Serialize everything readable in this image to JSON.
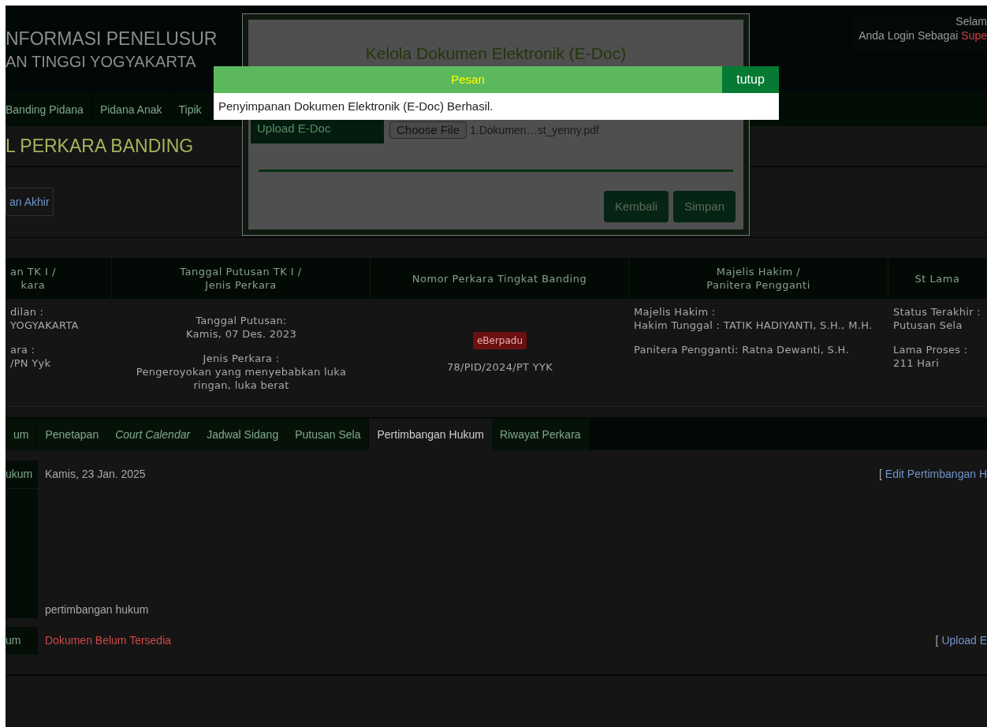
{
  "header": {
    "title": "NFORMASI PENELUSUR",
    "subtitle": "AN TINGGI YOGYAKARTA",
    "greeting": "Selam",
    "login_label": "Anda Login Sebagai",
    "login_role": "Supe"
  },
  "nav": {
    "items": [
      "Banding Pidana",
      "Pidana Anak",
      "Tipik"
    ]
  },
  "page_title": "L PERKARA BANDING",
  "action_button": "an Akhir",
  "table": {
    "columns": [
      "an TK I / kara",
      "Tanggal Putusan TK I / Jenis Perkara",
      "Nomor Perkara Tingkat Banding",
      "Majelis Hakim / Panitera Pengganti",
      "St Lama"
    ],
    "row": [
      {
        "blocks": [
          {
            "label": "dilan :",
            "value": "YOGYAKARTA"
          },
          {
            "label": "ara :",
            "value": "/PN Yyk"
          }
        ]
      },
      {
        "blocks": [
          {
            "label": "Tanggal Putusan:",
            "value": "Kamis, 07 Des. 2023"
          },
          {
            "label": "Jenis Perkara :",
            "value": "Pengeroyokan yang menyebabkan luka ringan, luka berat"
          }
        ]
      },
      {
        "badge": "eBerpadu",
        "blocks": [
          {
            "value": "78/PID/2024/PT YYK"
          }
        ]
      },
      {
        "blocks": [
          {
            "label": "Majelis Hakim :",
            "value": "Hakim Tunggal : TATIK HADIYANTI, S.H., M.H."
          },
          {
            "value": "Panitera Pengganti: Ratna Dewanti, S.H."
          }
        ]
      },
      {
        "blocks": [
          {
            "label": "Status Terakhir :",
            "value": "Putusan Sela"
          },
          {
            "label": "Lama Proses :",
            "value": "211 Hari"
          }
        ]
      }
    ]
  },
  "tabs": [
    {
      "label": "um",
      "selected": false,
      "italic": false
    },
    {
      "label": "Penetapan",
      "selected": false,
      "italic": false
    },
    {
      "label": "Court Calendar",
      "selected": false,
      "italic": true
    },
    {
      "label": "Jadwal Sidang",
      "selected": false,
      "italic": false
    },
    {
      "label": "Putusan Sela",
      "selected": false,
      "italic": false
    },
    {
      "label": "Pertimbangan Hukum",
      "selected": true,
      "italic": false
    },
    {
      "label": "Riwayat Perkara",
      "selected": false,
      "italic": false
    }
  ],
  "details": [
    {
      "kind": "date",
      "label": "ukum",
      "value": "Kamis, 23 Jan. 2025",
      "link_prefix": "[",
      "link": "Edit Pertimbangan H"
    },
    {
      "kind": "body",
      "value": "pertimbangan hukum"
    },
    {
      "kind": "missing",
      "label": "um",
      "value": "Dokumen Belum Tersedia",
      "link_prefix": "[",
      "link": "Upload E"
    }
  ],
  "modal": {
    "title": "Kelola Dokumen Elektronik (E-Doc)",
    "field_label": "Upload E-Doc",
    "file_button": "Choose File",
    "file_name": "1.Dokumen…st_yenny.pdf",
    "buttons": [
      "Kembali",
      "Simpan"
    ]
  },
  "alert": {
    "title": "Pesan",
    "close": "tutup",
    "message": "Penyimpanan Dokumen Elektronik (E-Doc) Berhasil."
  }
}
